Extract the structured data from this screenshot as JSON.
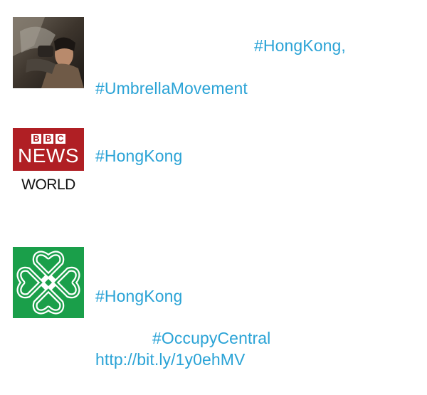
{
  "tweets": [
    {
      "avatar_icon": "photo-avatar",
      "hashtags": [
        "#HongKong,",
        "#UmbrellaMovement"
      ]
    },
    {
      "avatar_icon": "bbc-news-world-logo",
      "avatar_text": {
        "blocks": [
          "B",
          "B",
          "C"
        ],
        "news": "NEWS",
        "world": "WORLD"
      },
      "hashtags": [
        "#HongKong"
      ]
    },
    {
      "avatar_icon": "green-knot-logo",
      "hashtags": [
        "#HongKong",
        "#OccupyCentral"
      ],
      "link": "http://bit.ly/1y0ehMV"
    }
  ],
  "colors": {
    "link": "#2aa3d6",
    "bbc_red": "#b01f24",
    "logo_green": "#1a9f4a"
  }
}
